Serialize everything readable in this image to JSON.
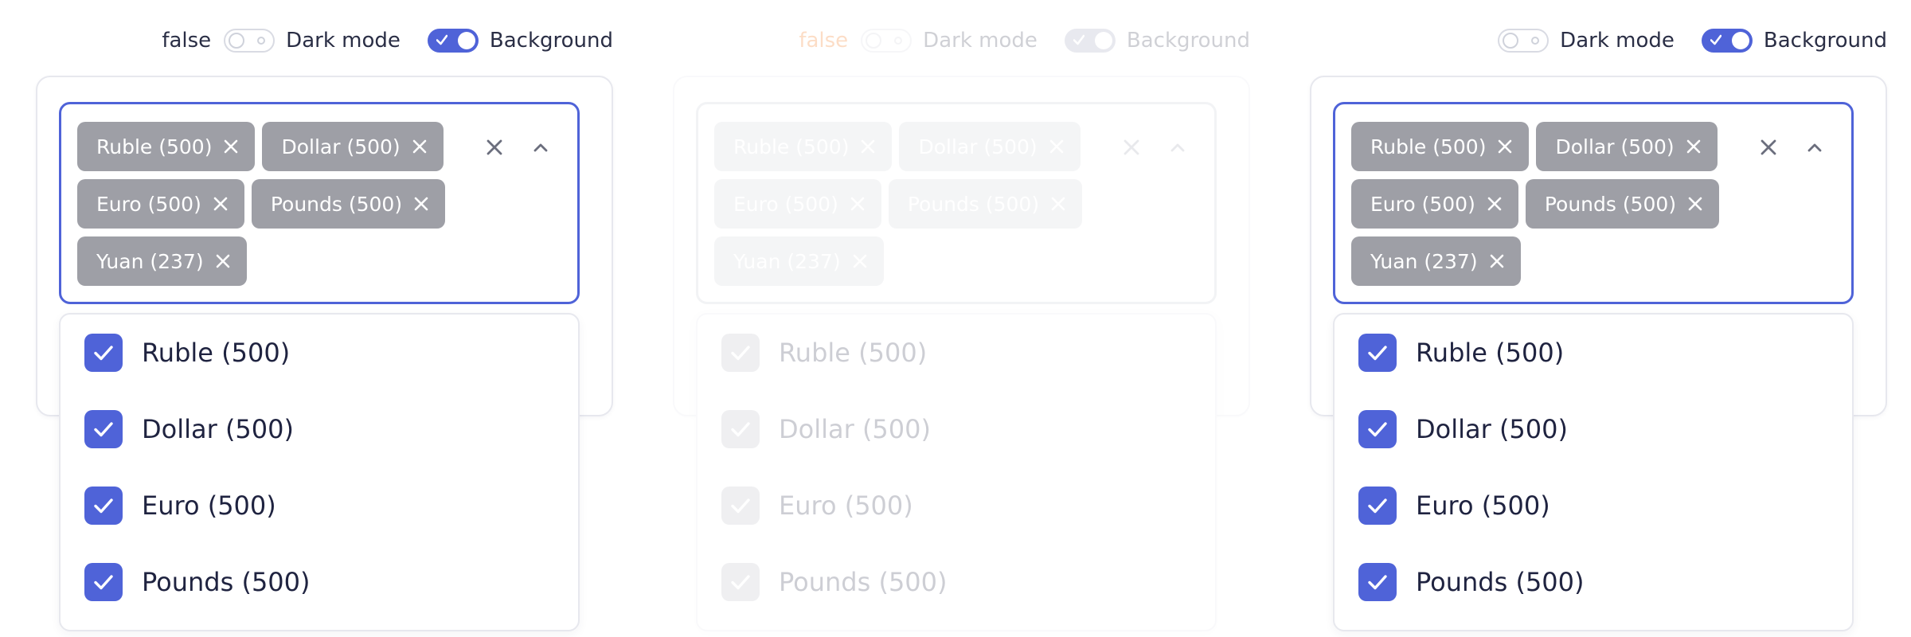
{
  "colors": {
    "accent": "#4f63d8",
    "chip": "#9e9fa6",
    "warning_text": "#f26a00"
  },
  "panels": [
    {
      "prefix": "false",
      "dark_mode_label": "Dark mode",
      "dark_mode": false,
      "background_label": "Background",
      "background": true,
      "chips": [
        "Ruble (500)",
        "Dollar (500)",
        "Euro (500)",
        "Pounds (500)",
        "Yuan (237)"
      ],
      "options": [
        "Ruble (500)",
        "Dollar (500)",
        "Euro (500)",
        "Pounds (500)"
      ]
    },
    {
      "prefix": "false",
      "dark_mode_label": "Dark mode",
      "dark_mode": false,
      "background_label": "Background",
      "background": true,
      "chips": [
        "Ruble (500)",
        "Dollar (500)",
        "Euro (500)",
        "Pounds (500)",
        "Yuan (237)"
      ],
      "options": [
        "Ruble (500)",
        "Dollar (500)",
        "Euro (500)",
        "Pounds (500)"
      ]
    },
    {
      "prefix": "",
      "dark_mode_label": "Dark mode",
      "dark_mode": false,
      "background_label": "Background",
      "background": true,
      "chips": [
        "Ruble (500)",
        "Dollar (500)",
        "Euro (500)",
        "Pounds (500)",
        "Yuan (237)"
      ],
      "options": [
        "Ruble (500)",
        "Dollar (500)",
        "Euro (500)",
        "Pounds (500)"
      ]
    }
  ],
  "icons": {
    "chip_remove": "close-icon",
    "clear": "close-icon",
    "collapse": "chevron-up-icon",
    "checked": "check-icon"
  }
}
